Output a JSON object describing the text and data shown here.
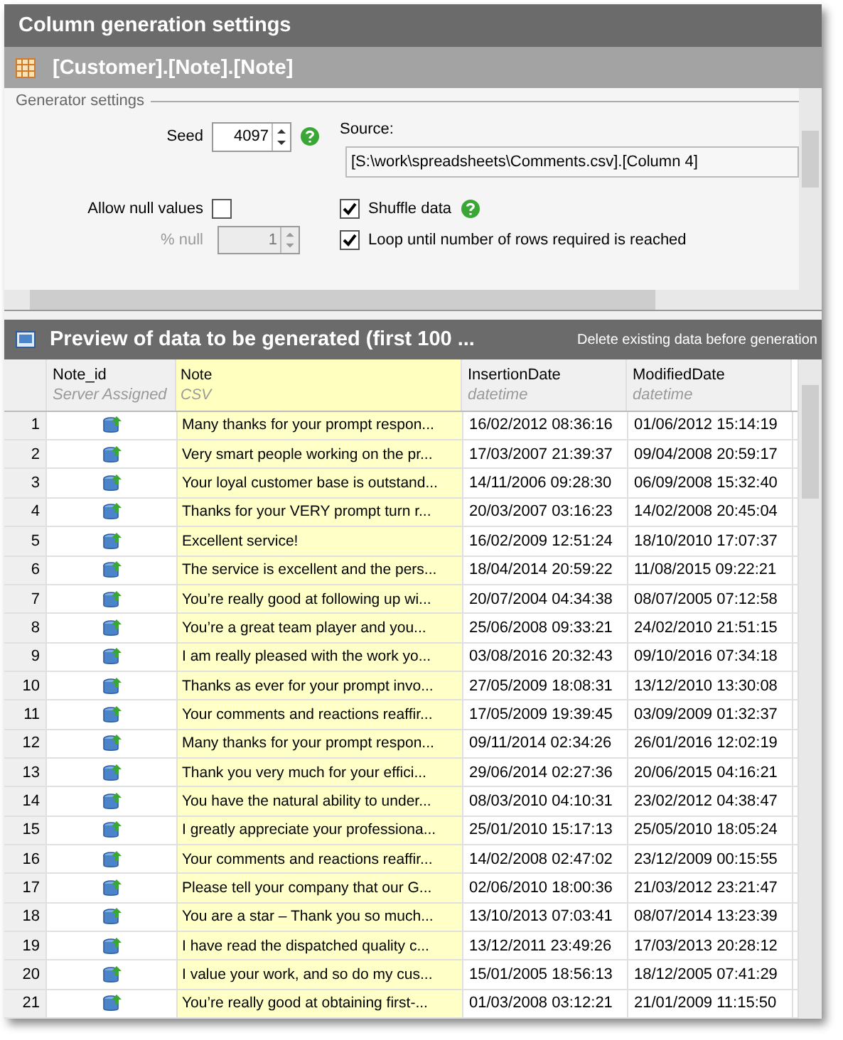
{
  "window": {
    "title": "Column generation settings"
  },
  "column_bar": {
    "title": "[Customer].[Note].[Note]"
  },
  "settings": {
    "group_label": "Generator settings",
    "seed_label": "Seed",
    "seed_value": "4097",
    "source_label": "Source:",
    "source_value": "[S:\\work\\spreadsheets\\Comments.csv].[Column 4]",
    "allow_null": {
      "label": "Allow null values",
      "checked": false
    },
    "percent_null": {
      "label": "% null",
      "value": "1",
      "disabled": true
    },
    "shuffle": {
      "label": "Shuffle data",
      "checked": true
    },
    "loop": {
      "label": "Loop until number of rows required is reached",
      "checked": true
    }
  },
  "preview": {
    "title": "Preview of data to be generated (first 100 ...",
    "delete_option": "Delete existing data before generation",
    "columns": [
      {
        "name": "Note_id",
        "type": "Server Assigned",
        "kind": "icon"
      },
      {
        "name": "Note",
        "type": "CSV",
        "kind": "note"
      },
      {
        "name": "InsertionDate",
        "type": "datetime",
        "kind": "date"
      },
      {
        "name": "ModifiedDate",
        "type": "datetime",
        "kind": "date"
      }
    ],
    "rows": [
      {
        "number": "1",
        "note": "Many thanks for your prompt respon...",
        "insertion": "16/02/2012 08:36:16",
        "modified": "01/06/2012 15:14:19"
      },
      {
        "number": "2",
        "note": "Very smart people working on the pr...",
        "insertion": "17/03/2007 21:39:37",
        "modified": "09/04/2008 20:59:17"
      },
      {
        "number": "3",
        "note": "Your loyal customer base is outstand...",
        "insertion": "14/11/2006 09:28:30",
        "modified": "06/09/2008 15:32:40"
      },
      {
        "number": "4",
        "note": "Thanks for your VERY prompt turn r...",
        "insertion": "20/03/2007 03:16:23",
        "modified": "14/02/2008 20:45:04"
      },
      {
        "number": "5",
        "note": "Excellent service!",
        "insertion": "16/02/2009 12:51:24",
        "modified": "18/10/2010 17:07:37"
      },
      {
        "number": "6",
        "note": "The service is excellent and the pers...",
        "insertion": "18/04/2014 20:59:22",
        "modified": "11/08/2015 09:22:21"
      },
      {
        "number": "7",
        "note": "You’re really good at following up wi...",
        "insertion": "20/07/2004 04:34:38",
        "modified": "08/07/2005 07:12:58"
      },
      {
        "number": "8",
        "note": "You’re a great team player and you...",
        "insertion": "25/06/2008 09:33:21",
        "modified": "24/02/2010 21:51:15"
      },
      {
        "number": "9",
        "note": "I am really pleased with the work yo...",
        "insertion": "03/08/2016 20:32:43",
        "modified": "09/10/2016 07:34:18"
      },
      {
        "number": "10",
        "note": "Thanks as ever for your prompt invo...",
        "insertion": "27/05/2009 18:08:31",
        "modified": "13/12/2010 13:30:08"
      },
      {
        "number": "11",
        "note": "Your comments and reactions reaffir...",
        "insertion": "17/05/2009 19:39:45",
        "modified": "03/09/2009 01:32:37"
      },
      {
        "number": "12",
        "note": "Many thanks for your prompt respon...",
        "insertion": "09/11/2014 02:34:26",
        "modified": "26/01/2016 12:02:19"
      },
      {
        "number": "13",
        "note": "Thank you very much for your effici...",
        "insertion": "29/06/2014 02:27:36",
        "modified": "20/06/2015 04:16:21"
      },
      {
        "number": "14",
        "note": "You have the natural ability to under...",
        "insertion": "08/03/2010 04:10:31",
        "modified": "23/02/2012 04:38:47"
      },
      {
        "number": "15",
        "note": "I greatly appreciate your professiona...",
        "insertion": "25/01/2010 15:17:13",
        "modified": "25/05/2010 18:05:24"
      },
      {
        "number": "16",
        "note": "Your comments and reactions reaffir...",
        "insertion": "14/02/2008 02:47:02",
        "modified": "23/12/2009 00:15:55"
      },
      {
        "number": "17",
        "note": "Please tell your company that our G...",
        "insertion": "02/06/2010 18:00:36",
        "modified": "21/03/2012 23:21:47"
      },
      {
        "number": "18",
        "note": "You are a star – Thank you so much...",
        "insertion": "13/10/2013 07:03:41",
        "modified": "08/07/2014 13:23:39"
      },
      {
        "number": "19",
        "note": "I have read the dispatched quality c...",
        "insertion": "13/12/2011 23:49:26",
        "modified": "17/03/2013 20:28:12"
      },
      {
        "number": "20",
        "note": "I value your work, and so do my cus...",
        "insertion": "15/01/2005 18:56:13",
        "modified": "18/12/2005 07:41:29"
      },
      {
        "number": "21",
        "note": "You’re really good at obtaining first-...",
        "insertion": "01/03/2008 03:12:21",
        "modified": "21/01/2009 11:15:50"
      }
    ]
  }
}
